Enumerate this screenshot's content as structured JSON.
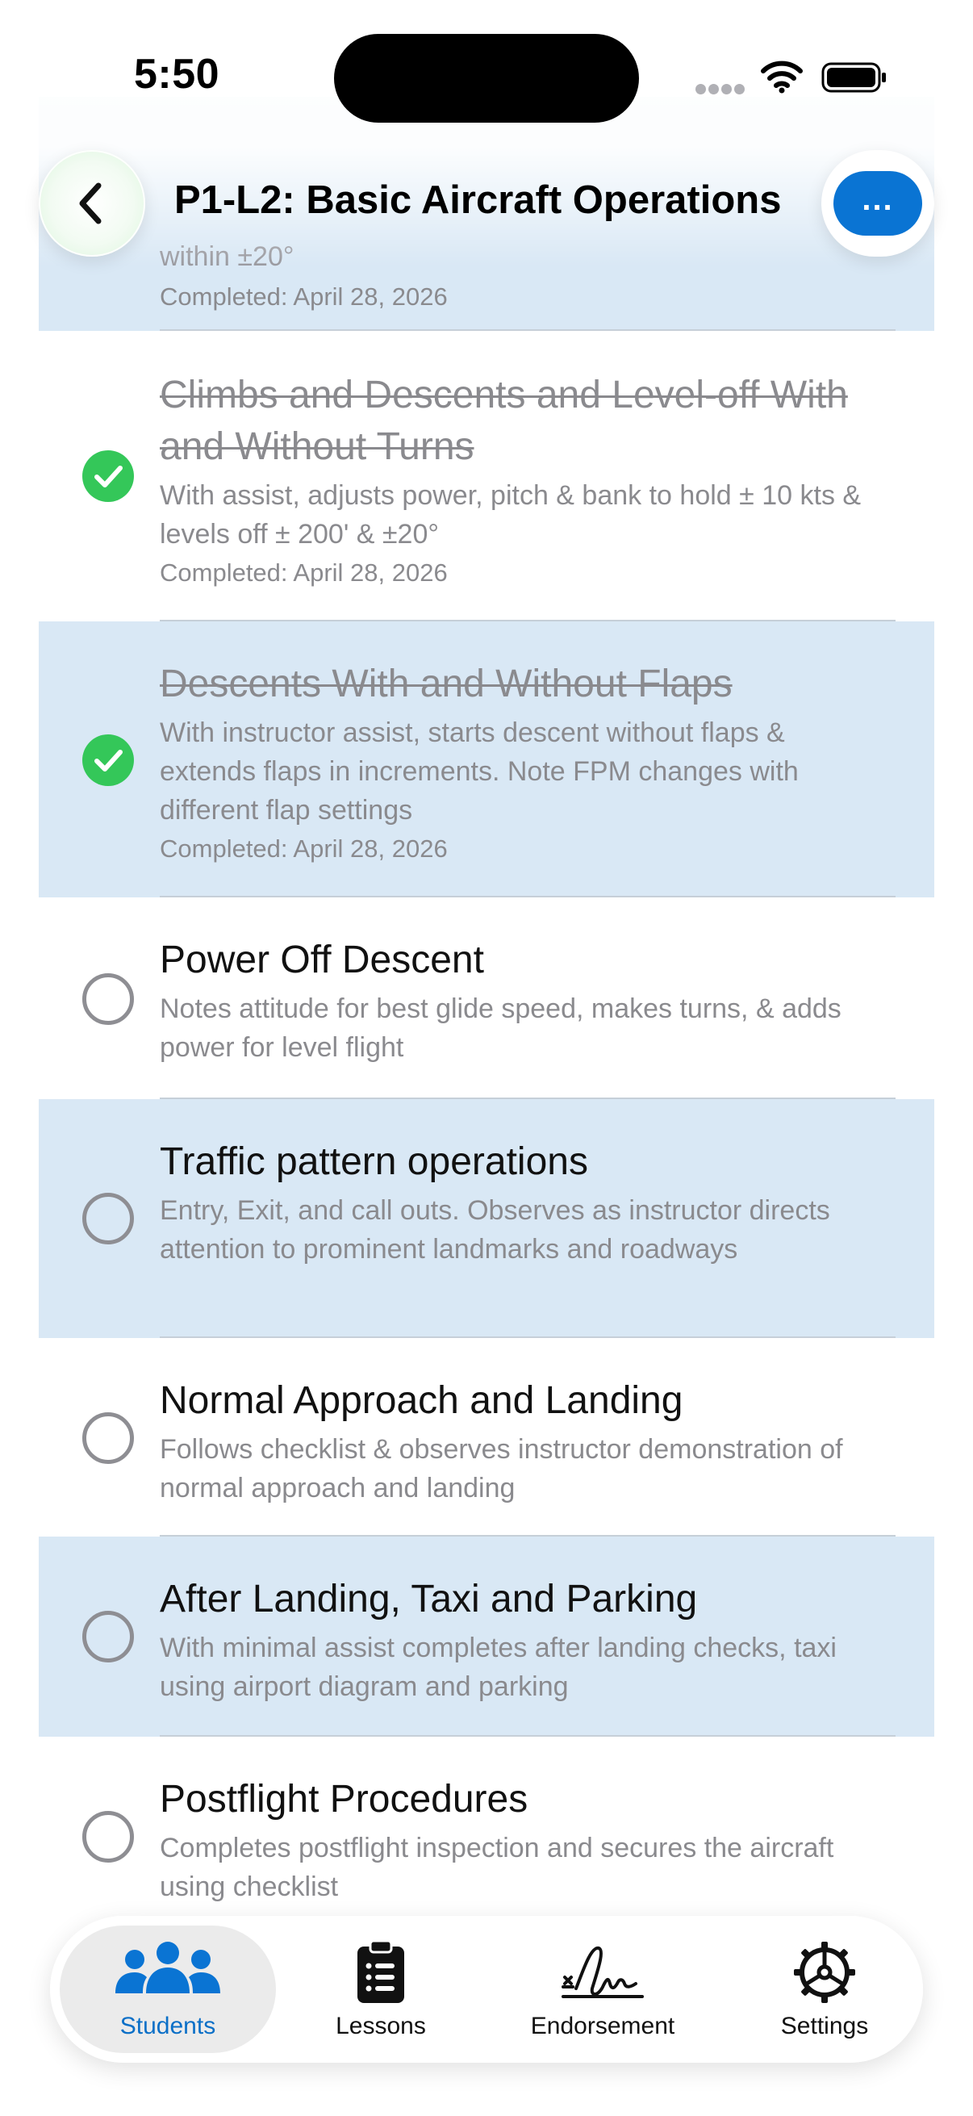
{
  "status_bar": {
    "time": "5:50"
  },
  "header": {
    "title": "P1-L2: Basic Aircraft Operations",
    "back_icon": "chevron-left-icon",
    "more_label": "..."
  },
  "colors": {
    "accent": "#0a74d3",
    "shaded_row": "#d9e8f5",
    "completed_check": "#34c759",
    "muted_text": "#8a8a8e"
  },
  "partial_row": {
    "desc_tail": "within ±20°",
    "completed": "Completed: April 28, 2026"
  },
  "items": [
    {
      "title": "Climbs and Descents and Level-off With and Without Turns",
      "description": "With assist, adjusts power, pitch & bank to hold ± 10 kts  & levels off  ± 200' & ±20°",
      "completed": "Completed: April 28, 2026",
      "done": true
    },
    {
      "title": "Descents With and Without Flaps",
      "description": "With instructor assist, starts descent without flaps & extends flaps in increments. Note FPM changes with different flap settings",
      "completed": "Completed: April 28, 2026",
      "done": true
    },
    {
      "title": "Power Off Descent",
      "description": "Notes attitude for best glide speed, makes turns, & adds power for level flight",
      "done": false
    },
    {
      "title": "Traffic pattern operations",
      "description": "Entry, Exit, and call outs. Observes as instructor directs attention to prominent landmarks and roadways",
      "done": false
    },
    {
      "title": "Normal Approach and Landing",
      "description": "Follows checklist & observes instructor demonstration of normal approach and landing",
      "done": false
    },
    {
      "title": "After Landing, Taxi and Parking",
      "description": "With minimal assist completes after landing checks, taxi using airport diagram and parking",
      "done": false
    },
    {
      "title": "Postflight Procedures",
      "description": "Completes postflight inspection and secures the aircraft using checklist",
      "done": false
    }
  ],
  "tab_bar": {
    "tabs": [
      {
        "label": "Students",
        "icon": "people-icon",
        "active": true
      },
      {
        "label": "Lessons",
        "icon": "clipboard-icon",
        "active": false
      },
      {
        "label": "Endorsement",
        "icon": "signature-icon",
        "active": false
      },
      {
        "label": "Settings",
        "icon": "gear-icon",
        "active": false
      }
    ]
  }
}
